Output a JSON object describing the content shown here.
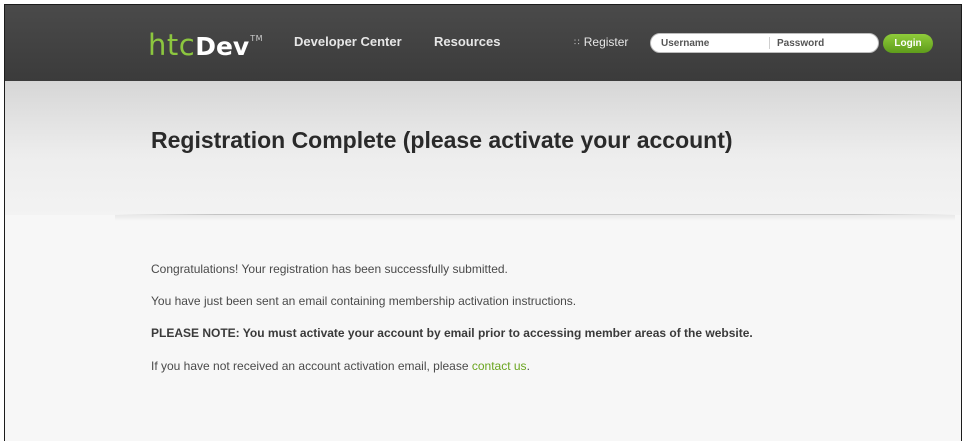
{
  "header": {
    "logo_main": "htc",
    "logo_dev": "Dev",
    "logo_tm": "TM",
    "nav": [
      {
        "label": "Developer Center"
      },
      {
        "label": "Resources"
      }
    ],
    "register_label": "Register",
    "username_placeholder": "Username",
    "password_placeholder": "Password",
    "login_label": "Login"
  },
  "main": {
    "title": "Registration Complete (please activate your account)",
    "p1": "Congratulations! Your registration has been successfully submitted.",
    "p2": "You have just been sent an email containing membership activation instructions.",
    "p3": "PLEASE NOTE: You must activate your account by email prior to accessing member areas of the website.",
    "p4_prefix": "If you have not received an account activation email, please ",
    "p4_link": "contact us",
    "p4_suffix": "."
  },
  "colors": {
    "accent": "#8cc63f",
    "link": "#6aa51f",
    "topbar": "#404040"
  }
}
